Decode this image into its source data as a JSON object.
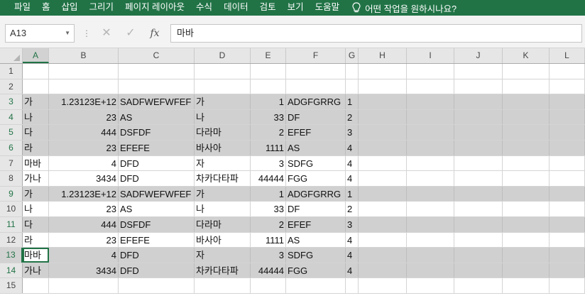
{
  "ribbon": {
    "tabs": [
      "파일",
      "홈",
      "삽입",
      "그리기",
      "페이지 레이아웃",
      "수식",
      "데이터",
      "검토",
      "보기",
      "도움말"
    ],
    "tell_me": "어떤 작업을 원하시나요?",
    "tell_me_icon": "lightbulb-icon"
  },
  "formula_bar": {
    "name_box": "A13",
    "content": "마바",
    "fx_label": "fx"
  },
  "columns": [
    "A",
    "B",
    "C",
    "D",
    "E",
    "F",
    "G",
    "H",
    "I",
    "J",
    "K",
    "L"
  ],
  "selected_column": "A",
  "selected_row": "13",
  "rows": [
    {
      "n": "1",
      "highlight": false,
      "cells": [
        "",
        "",
        "",
        "",
        "",
        "",
        "",
        "",
        "",
        "",
        "",
        ""
      ]
    },
    {
      "n": "2",
      "highlight": false,
      "cells": [
        "",
        "",
        "",
        "",
        "",
        "",
        "",
        "",
        "",
        "",
        "",
        ""
      ]
    },
    {
      "n": "3",
      "highlight": true,
      "cells": [
        "가",
        "1.23123E+12",
        "SADFWEFWFEF",
        "가",
        "1",
        "ADGFGRRG",
        "1",
        "",
        "",
        "",
        "",
        ""
      ]
    },
    {
      "n": "4",
      "highlight": true,
      "cells": [
        "나",
        "23",
        "AS",
        "나",
        "33",
        "DF",
        "2",
        "",
        "",
        "",
        "",
        ""
      ]
    },
    {
      "n": "5",
      "highlight": true,
      "cells": [
        "다",
        "444",
        "DSFDF",
        "다라마",
        "2",
        "EFEF",
        "3",
        "",
        "",
        "",
        "",
        ""
      ]
    },
    {
      "n": "6",
      "highlight": true,
      "cells": [
        "라",
        "23",
        "EFEFE",
        "바사아",
        "1111",
        "AS",
        "4",
        "",
        "",
        "",
        "",
        ""
      ]
    },
    {
      "n": "7",
      "highlight": false,
      "cells": [
        "마바",
        "4",
        "DFD",
        "자",
        "3",
        "SDFG",
        "4",
        "",
        "",
        "",
        "",
        ""
      ]
    },
    {
      "n": "8",
      "highlight": false,
      "cells": [
        "가나",
        "3434",
        "DFD",
        "차카다타파",
        "44444",
        "FGG",
        "4",
        "",
        "",
        "",
        "",
        ""
      ]
    },
    {
      "n": "9",
      "highlight": true,
      "cells": [
        "가",
        "1.23123E+12",
        "SADFWEFWFEF",
        "가",
        "1",
        "ADGFGRRG",
        "1",
        "",
        "",
        "",
        "",
        ""
      ]
    },
    {
      "n": "10",
      "highlight": false,
      "cells": [
        "나",
        "23",
        "AS",
        "나",
        "33",
        "DF",
        "2",
        "",
        "",
        "",
        "",
        ""
      ]
    },
    {
      "n": "11",
      "highlight": true,
      "cells": [
        "다",
        "444",
        "DSFDF",
        "다라마",
        "2",
        "EFEF",
        "3",
        "",
        "",
        "",
        "",
        ""
      ]
    },
    {
      "n": "12",
      "highlight": false,
      "cells": [
        "라",
        "23",
        "EFEFE",
        "바사아",
        "1111",
        "AS",
        "4",
        "",
        "",
        "",
        "",
        ""
      ]
    },
    {
      "n": "13",
      "highlight": true,
      "cells": [
        "마바",
        "4",
        "DFD",
        "자",
        "3",
        "SDFG",
        "4",
        "",
        "",
        "",
        "",
        ""
      ]
    },
    {
      "n": "14",
      "highlight": true,
      "cells": [
        "가나",
        "3434",
        "DFD",
        "차카다타파",
        "44444",
        "FGG",
        "4",
        "",
        "",
        "",
        "",
        ""
      ]
    },
    {
      "n": "15",
      "highlight": false,
      "cells": [
        "",
        "",
        "",
        "",
        "",
        "",
        "",
        "",
        "",
        "",
        "",
        ""
      ]
    }
  ],
  "numeric_columns": [
    "B",
    "E"
  ],
  "colors": {
    "accent": "#217346",
    "highlight_row": "#d0d0d0"
  }
}
